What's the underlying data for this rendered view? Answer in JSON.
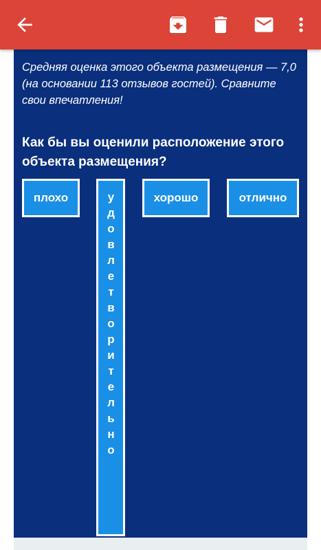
{
  "toolbar": {
    "back_icon": "arrow-back-icon",
    "archive_icon": "archive-icon",
    "delete_icon": "delete-icon",
    "mark_unread_icon": "mail-icon",
    "more_icon": "more-vert-icon",
    "color": "#db4437"
  },
  "email": {
    "intro": "Средняя оценка этого объекта размещения — 7,0 (на основании 113 отзывов гостей). Сравните свои впечатления!",
    "question": "Как бы вы оценили расположение этого объекта размещения?",
    "options": [
      {
        "label": "плохо"
      },
      {
        "label": "удовлетворительно"
      },
      {
        "label": "хорошо"
      },
      {
        "label": "отлично"
      }
    ],
    "background": "#0a2f7c",
    "button_color": "#1a8fe6"
  }
}
